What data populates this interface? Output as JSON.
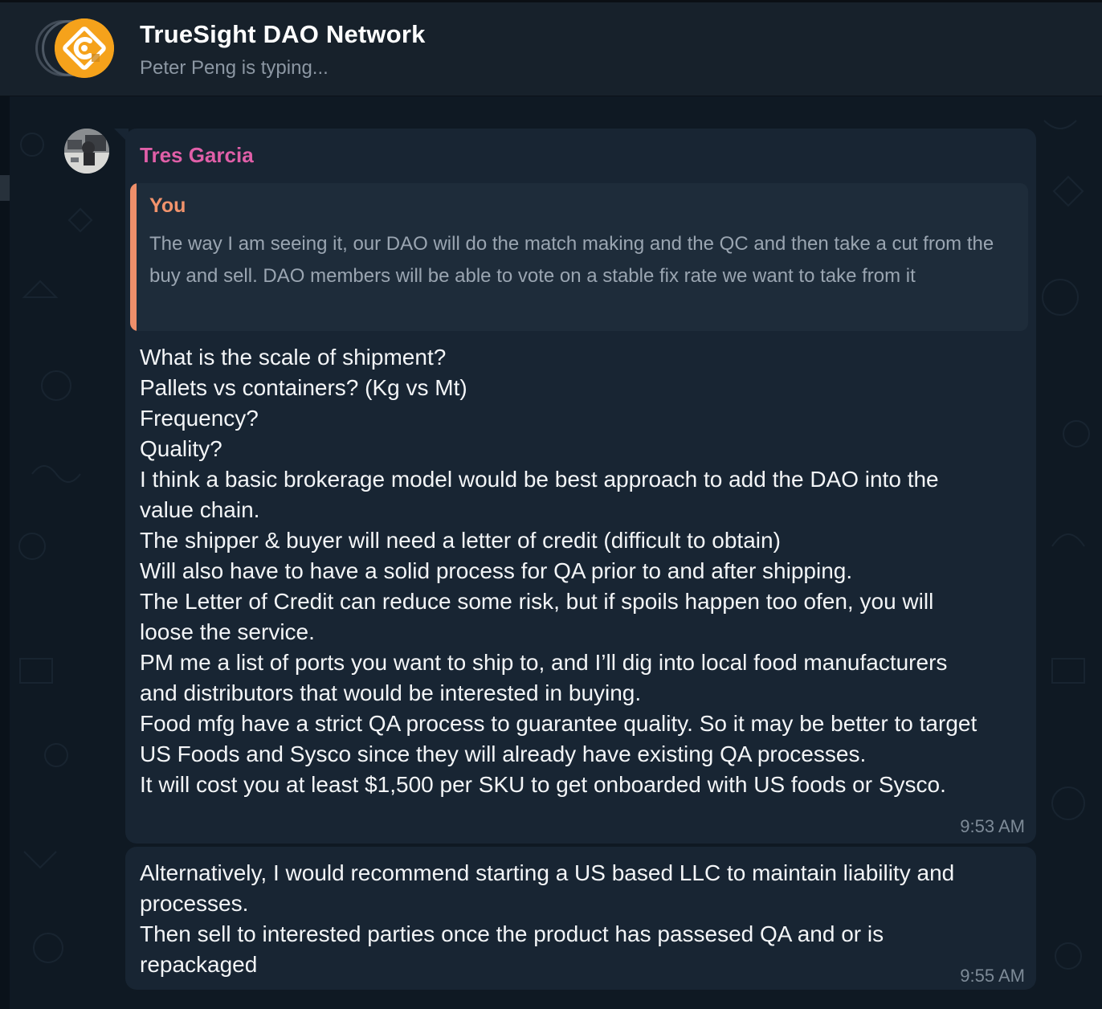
{
  "header": {
    "title": "TrueSight DAO Network",
    "status": "Peter Peng is typing..."
  },
  "messages": [
    {
      "sender": "Tres Garcia",
      "sender_color": "#e05fa8",
      "reply": {
        "author": "You",
        "author_color": "#f2936c",
        "text": "The way I am seeing it, our DAO will do the match making and the QC and then take a cut from the buy and sell. DAO members will be able to vote on a stable fix rate we want to take from it"
      },
      "lines": [
        "What is the scale of shipment?",
        "Pallets vs containers? (Kg vs Mt)",
        "Frequency?",
        "Quality?",
        "I think a basic brokerage model would be best approach to add the DAO into the",
        "value chain.",
        "The shipper & buyer will need a letter of credit (difficult to obtain)",
        "Will also have to have a solid process for QA prior to and after shipping.",
        "The Letter of Credit can reduce some risk, but if spoils happen too ofen, you will",
        "loose the service.",
        "PM me a list of ports you want to ship to, and I’ll dig into local food manufacturers",
        "and distributors that would be interested in buying.",
        "Food mfg have a strict QA process to guarantee quality. So it may be better to target",
        "US Foods and Sysco since they will already have existing QA processes.",
        "It will cost you at least $1,500 per SKU to get onboarded with US foods or Sysco."
      ],
      "time": "9:53 AM"
    },
    {
      "lines": [
        "Alternatively, I would recommend starting a US based LLC to maintain liability and",
        "processes.",
        "Then sell to interested parties once the product has passesed QA and or is",
        "repackaged"
      ],
      "time": "9:55 AM"
    }
  ],
  "icons": {
    "group_avatar": "truesight-logo-icon",
    "sender_avatar": "user-photo-avatar"
  },
  "colors": {
    "header_bg": "#17212b",
    "chat_bg": "#0f1923",
    "bubble_bg": "#182533",
    "accent_reply": "#ef8f6a"
  }
}
